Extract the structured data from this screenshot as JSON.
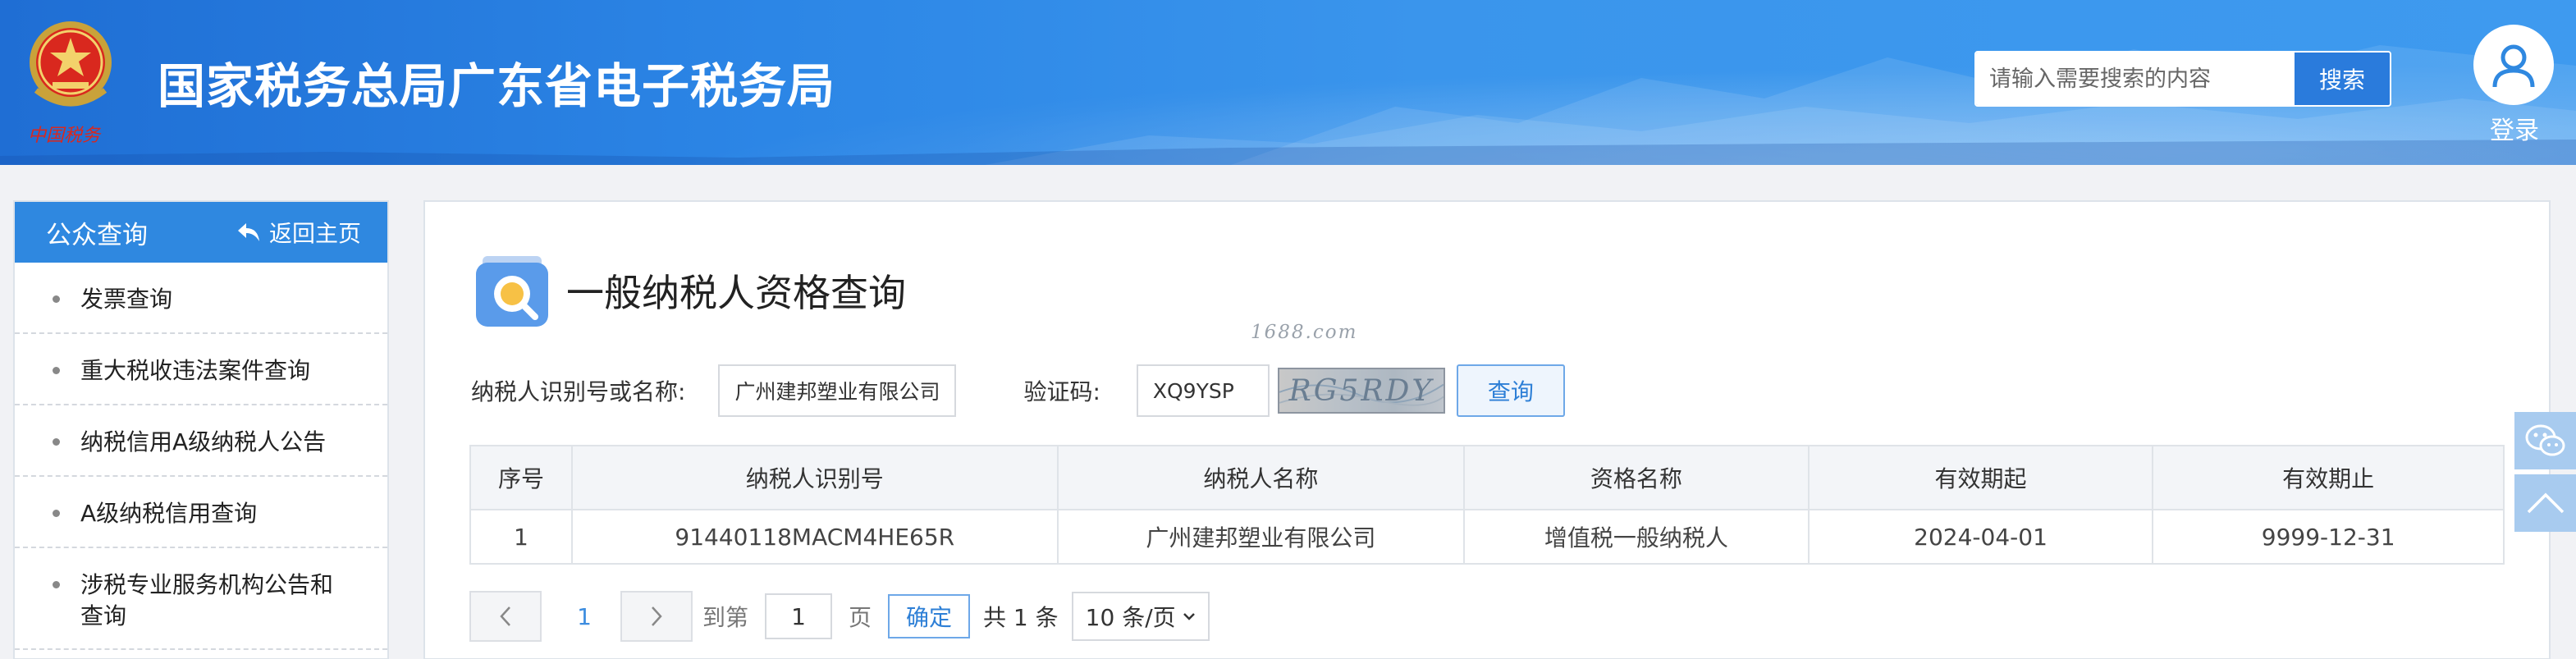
{
  "header": {
    "site_title": "国家税务总局广东省电子税务局",
    "emblem_text": "中国税务",
    "search_placeholder": "请输入需要搜索的内容",
    "search_button": "搜索",
    "login_label": "登录"
  },
  "sidebar": {
    "title": "公众查询",
    "back_home": "返回主页",
    "items": [
      {
        "label": "发票查询"
      },
      {
        "label": "重大税收违法案件查询"
      },
      {
        "label": "纳税信用A级纳税人公告"
      },
      {
        "label": "A级纳税信用查询"
      },
      {
        "label": "涉税专业服务机构公告和查询"
      }
    ]
  },
  "main": {
    "page_title": "一般纳税人资格查询",
    "watermark": "1688.com",
    "form": {
      "taxpayer_label": "纳税人识别号或名称:",
      "taxpayer_value": "广州建邦塑业有限公司",
      "captcha_label": "验证码:",
      "captcha_value": "XQ9YSP",
      "captcha_image_text": "RG5RDY",
      "query_button": "查询"
    },
    "table": {
      "headers": [
        "序号",
        "纳税人识别号",
        "纳税人名称",
        "资格名称",
        "有效期起",
        "有效期止"
      ],
      "rows": [
        [
          "1",
          "91440118MACM4HE65R",
          "广州建邦塑业有限公司",
          "增值税一般纳税人",
          "2024-04-01",
          "9999-12-31"
        ]
      ]
    },
    "pagination": {
      "current_page": "1",
      "goto_label": "到第",
      "goto_value": "1",
      "page_unit": "页",
      "confirm": "确定",
      "total": "共 1 条",
      "page_size": "10 条/页"
    }
  },
  "icons": {
    "back": "back-arrow-icon",
    "user": "user-icon",
    "query": "search-query-icon",
    "wechat": "wechat-icon",
    "to_top": "chevron-up-icon"
  },
  "colors": {
    "header_blue": "#2c86e6",
    "sidebar_head": "#2f88e0",
    "link_blue": "#2d7fd6"
  }
}
